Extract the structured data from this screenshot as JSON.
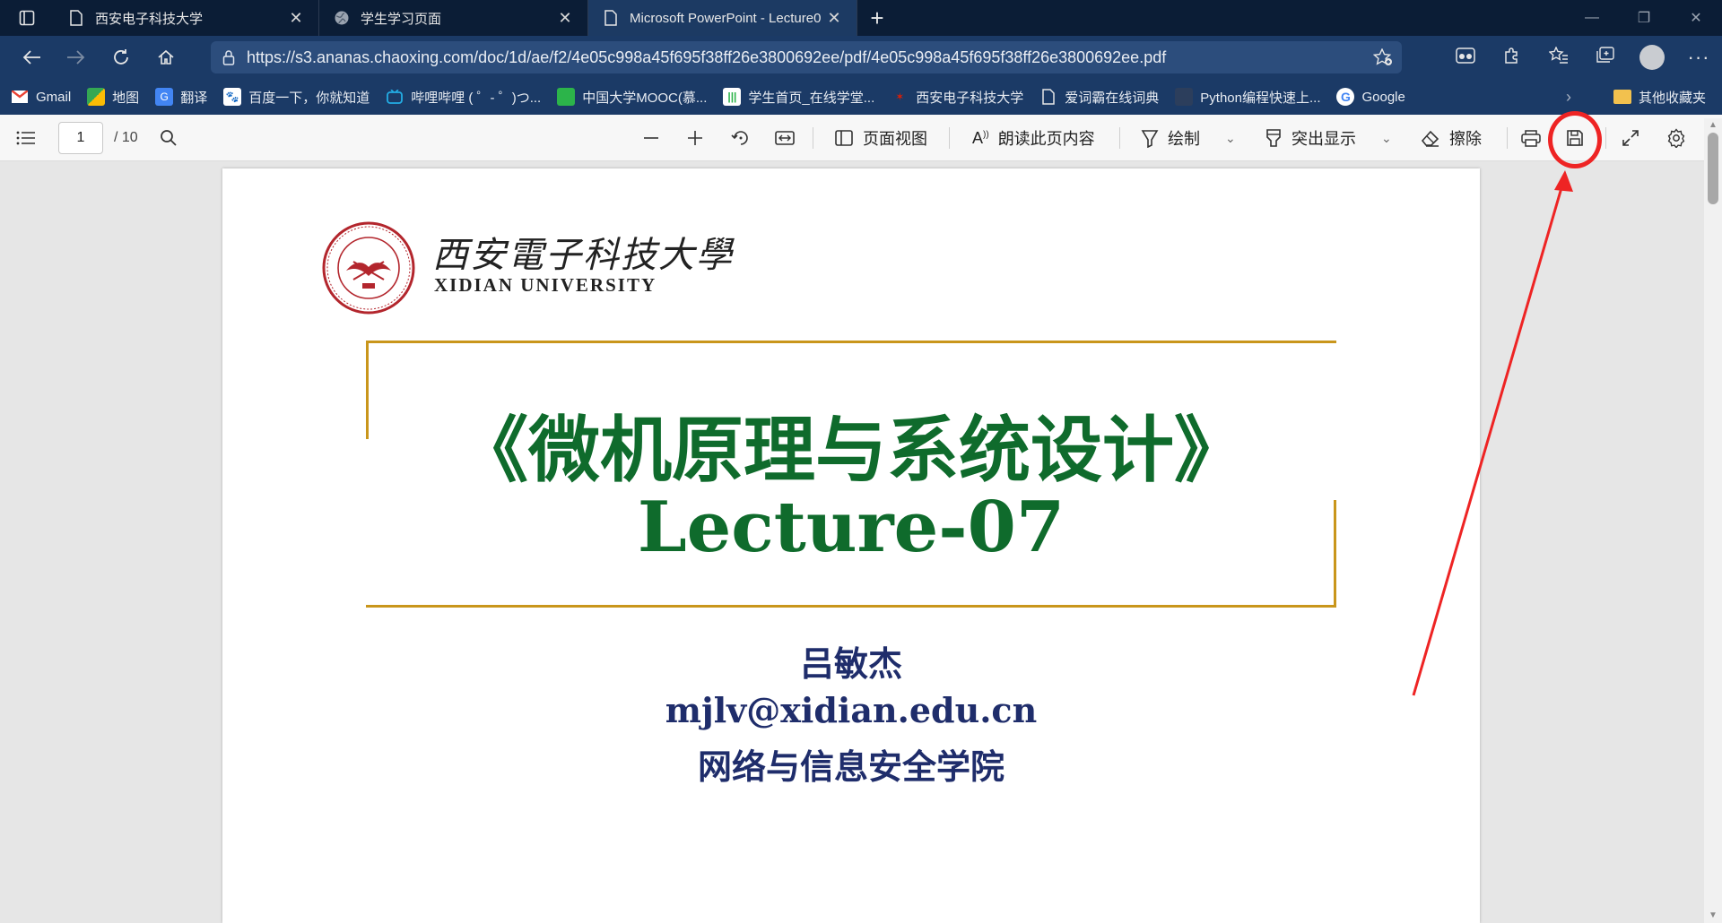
{
  "tabs": [
    {
      "title": "西安电子科技大学",
      "icon": "page-icon",
      "active": false
    },
    {
      "title": "学生学习页面",
      "icon": "globe-icon",
      "active": false
    },
    {
      "title": "Microsoft PowerPoint - Lecture0",
      "icon": "page-icon",
      "active": true
    }
  ],
  "address": {
    "url": "https://s3.ananas.chaoxing.com/doc/1d/ae/f2/4e05c998a45f695f38ff26e3800692ee/pdf/4e05c998a45f695f38ff26e3800692ee.pdf"
  },
  "bookmarks": [
    {
      "label": "Gmail",
      "icon": "gmail-icon",
      "color": "#ea4335"
    },
    {
      "label": "地图",
      "icon": "maps-icon",
      "color": "#34a853"
    },
    {
      "label": "翻译",
      "icon": "translate-icon",
      "color": "#4285f4"
    },
    {
      "label": "百度一下，你就知道",
      "icon": "baidu-icon",
      "color": "#2932e1"
    },
    {
      "label": "哔哩哔哩 ( ゜- ゜)つ...",
      "icon": "bilibili-icon",
      "color": "#23ade5"
    },
    {
      "label": "中国大学MOOC(慕...",
      "icon": "mooc-icon",
      "color": "#2cb44a"
    },
    {
      "label": "学生首页_在线学堂...",
      "icon": "xuetang-icon",
      "color": "#ffffff"
    },
    {
      "label": "西安电子科技大学",
      "icon": "xidian-icon",
      "color": "#d81e06"
    },
    {
      "label": "爱词霸在线词典",
      "icon": "page-icon",
      "color": "#ffffff"
    },
    {
      "label": "Python编程快速上...",
      "icon": "python-icon",
      "color": "#3a3a3a"
    },
    {
      "label": "Google",
      "icon": "google-icon",
      "color": "#ffffff"
    }
  ],
  "other_bookmarks": "其他收藏夹",
  "pdf_toolbar": {
    "page_current": "1",
    "page_total": "/ 10",
    "page_view": "页面视图",
    "read_aloud": "朗读此页内容",
    "draw": "绘制",
    "highlight": "突出显示",
    "erase": "擦除"
  },
  "slide": {
    "university_cn": "西安電子科技大學",
    "university_en": "XIDIAN UNIVERSITY",
    "title_cn": "《微机原理与系统设计》",
    "title_en": "Lecture-07",
    "author": "吕敏杰",
    "email": "mjlv@xidian.edu.cn",
    "school": "网络与信息安全学院"
  },
  "colors": {
    "title_green": "#0f6b2c",
    "author_navy": "#1f2d6b",
    "frame_gold": "#c9961c",
    "annotation_red": "#ee2424",
    "browser_dark": "#0b1d36",
    "browser_blue": "#1b3a66"
  }
}
